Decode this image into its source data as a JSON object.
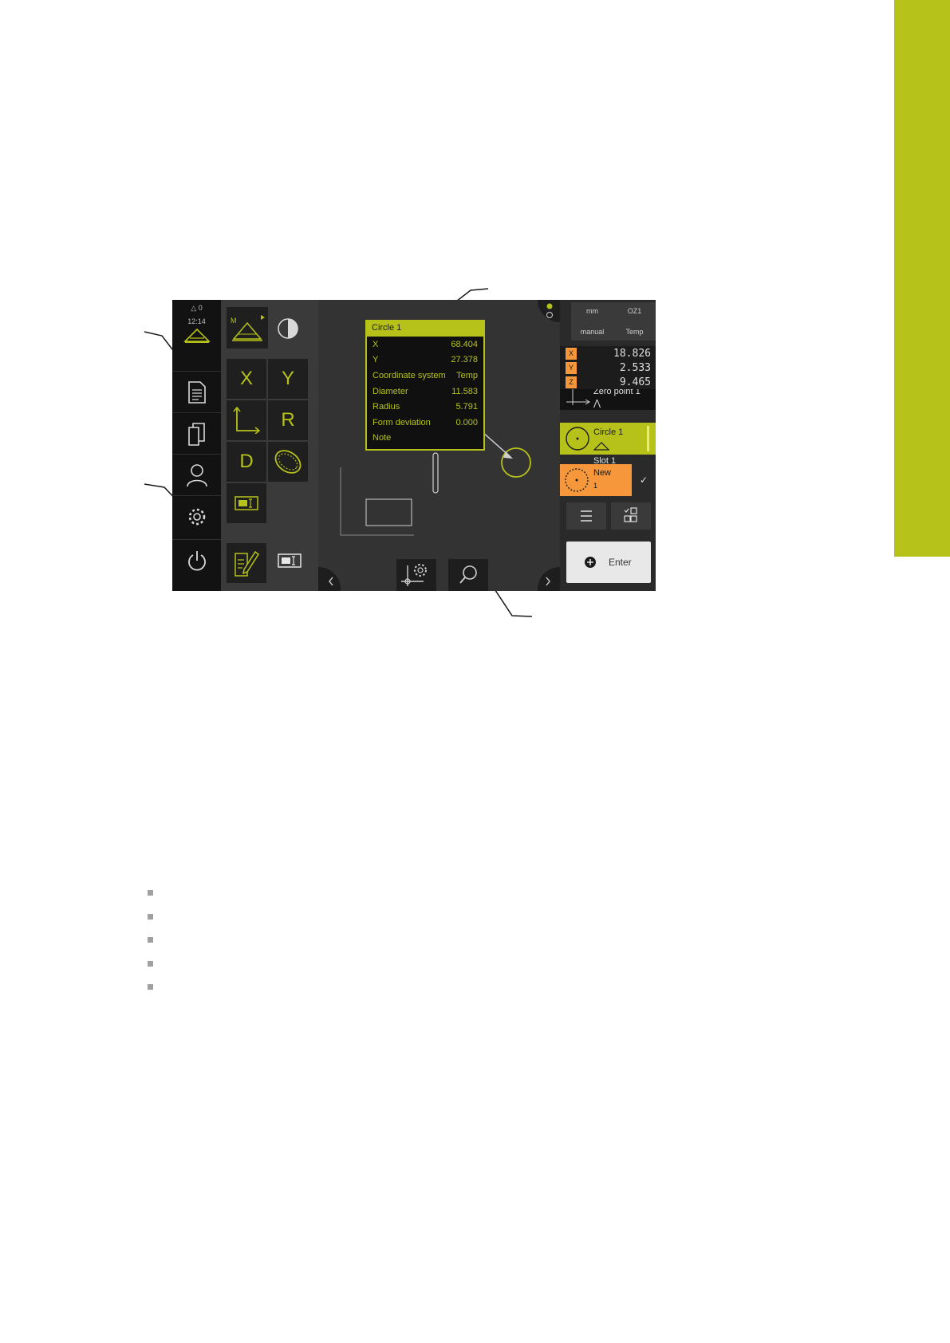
{
  "status": {
    "warnings": "0",
    "time": "12:14"
  },
  "popup": {
    "title": "Circle 1",
    "rows": [
      {
        "label": "X",
        "value": "68.404"
      },
      {
        "label": "Y",
        "value": "27.378"
      },
      {
        "label": "Coordinate system",
        "value": "Temp"
      },
      {
        "label": "Diameter",
        "value": "11.583"
      },
      {
        "label": "Radius",
        "value": "5.791"
      },
      {
        "label": "Form deviation",
        "value": "0.000"
      },
      {
        "label": "Note",
        "value": ""
      }
    ]
  },
  "toolbar": {
    "x": "X",
    "y": "Y",
    "r": "R",
    "d": "D",
    "mode_letter": "M"
  },
  "inspector": {
    "unit": "mm",
    "preset": "OZ1",
    "mode": "manual",
    "coord_system": "Temp",
    "positions": [
      {
        "axis": "X",
        "value": "18.826"
      },
      {
        "axis": "Y",
        "value": "2.533"
      },
      {
        "axis": "Z",
        "value": "9.465"
      }
    ],
    "features": [
      {
        "name": "Zero point 1"
      },
      {
        "name": "Circle 1"
      },
      {
        "name": "Slot 1"
      }
    ],
    "new_feature": {
      "name": "New",
      "count": "1"
    },
    "enter_label": "Enter"
  },
  "colors": {
    "accent": "#b6c21a",
    "new_feature": "#f5973a",
    "tab": "#b6c21a"
  }
}
